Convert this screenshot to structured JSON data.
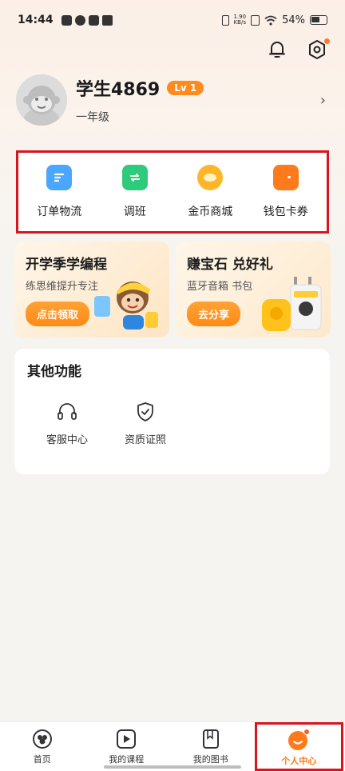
{
  "status_bar": {
    "time": "14:44",
    "net_speed_value": "1.90",
    "net_speed_unit": "KB/s",
    "battery": "54%"
  },
  "profile": {
    "username": "学生4869",
    "level": "Lv 1",
    "grade": "一年级"
  },
  "quick_actions": [
    {
      "label": "订单物流",
      "icon": "order-logistics-icon",
      "color": "#4aa6ff"
    },
    {
      "label": "调班",
      "icon": "switch-class-icon",
      "color": "#2ecb7c"
    },
    {
      "label": "金币商城",
      "icon": "coin-mall-icon",
      "color": "#ffb52a"
    },
    {
      "label": "钱包卡券",
      "icon": "wallet-icon",
      "color": "#ff7a1a"
    }
  ],
  "promos": {
    "left": {
      "title": "开学季学编程",
      "subtitle": "练思维提升专注",
      "button": "点击领取"
    },
    "right": {
      "title": "赚宝石 兑好礼",
      "subtitle": "蓝牙音箱 书包",
      "button": "去分享"
    }
  },
  "other": {
    "title": "其他功能",
    "items": [
      {
        "label": "客服中心",
        "icon": "headset-icon"
      },
      {
        "label": "资质证照",
        "icon": "shield-check-icon"
      }
    ]
  },
  "bottom_nav": [
    {
      "label": "首页",
      "icon": "home-icon"
    },
    {
      "label": "我的课程",
      "icon": "play-course-icon"
    },
    {
      "label": "我的图书",
      "icon": "book-icon"
    },
    {
      "label": "个人中心",
      "icon": "profile-smile-icon",
      "active": true
    }
  ],
  "colors": {
    "accent": "#ff8a1e",
    "highlight_box": "#d8141e"
  }
}
